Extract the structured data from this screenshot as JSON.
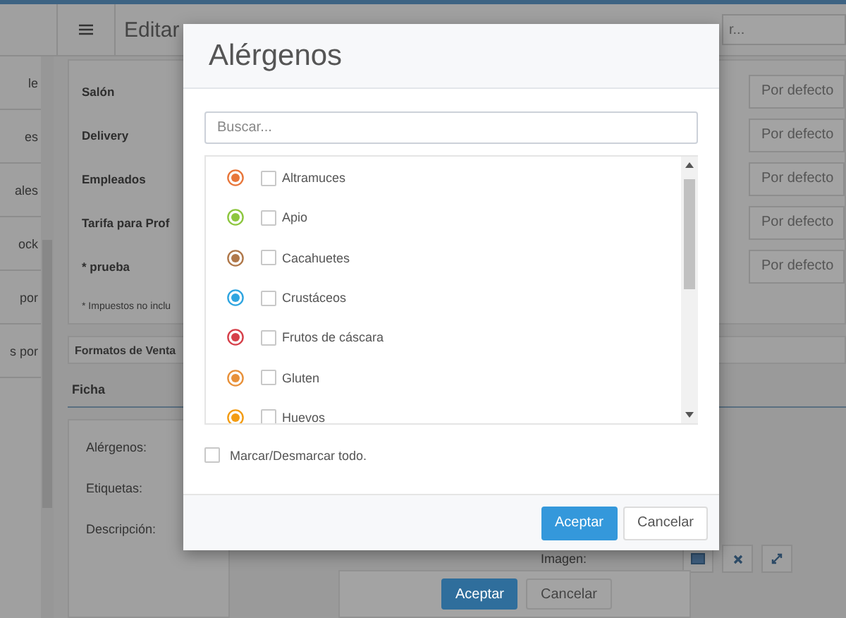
{
  "header": {
    "title": "Editar",
    "search": {
      "placeholder": "r..."
    }
  },
  "sidebar": {
    "items": [
      "le",
      "es",
      "ales",
      "ock",
      "por",
      "s por"
    ]
  },
  "price_rows": [
    {
      "label": "Salón",
      "value": "Por defecto"
    },
    {
      "label": "Delivery",
      "value": "Por defecto"
    },
    {
      "label": "Empleados",
      "value": "Por defecto"
    },
    {
      "label": "Tarifa para Prof",
      "value": "Por defecto"
    },
    {
      "label": "* prueba",
      "value": "Por defecto"
    }
  ],
  "tax_note": "* Impuestos no inclu",
  "sections": [
    "Formatos de Venta"
  ],
  "tabs": [
    {
      "label": "Ficha",
      "selected": true
    }
  ],
  "ficha_fields": [
    "Alérgenos:",
    "Etiquetas:",
    "Descripción:"
  ],
  "image_label": "Imagen:",
  "page_buttons": [
    {
      "label": "Aceptar",
      "kind": "primary"
    },
    {
      "label": "Cancelar",
      "kind": "default"
    }
  ],
  "modal": {
    "title": "Alérgenos",
    "search": {
      "placeholder": "Buscar..."
    },
    "allergens": [
      {
        "name": "Altramuces",
        "color": "#e8763a",
        "checked": false
      },
      {
        "name": "Apio",
        "color": "#8dc63f",
        "checked": false
      },
      {
        "name": "Cacahuetes",
        "color": "#b0784a",
        "checked": false
      },
      {
        "name": "Crustáceos",
        "color": "#2fa5e0",
        "checked": false
      },
      {
        "name": "Frutos de cáscara",
        "color": "#d6404a",
        "checked": false
      },
      {
        "name": "Gluten",
        "color": "#e8913a",
        "checked": false
      },
      {
        "name": "Huevos",
        "color": "#f39c12",
        "checked": false
      }
    ],
    "select_all": {
      "label": "Marcar/Desmarcar todo.",
      "checked": false
    },
    "buttons": [
      {
        "label": "Aceptar",
        "kind": "primary"
      },
      {
        "label": "Cancelar",
        "kind": "default"
      }
    ]
  }
}
